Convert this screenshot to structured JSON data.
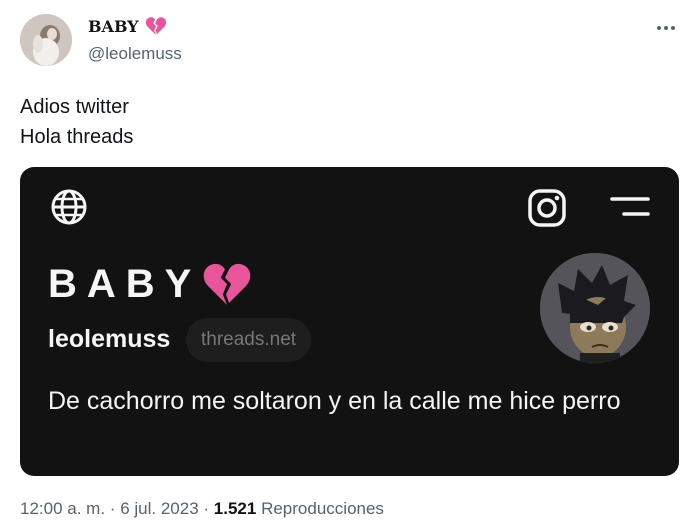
{
  "author": {
    "display_name": "BABY",
    "display_emoji": "broken-heart-icon",
    "handle": "@leolemuss"
  },
  "tweet": {
    "lines": [
      "Adios twitter",
      "Hola threads"
    ]
  },
  "card": {
    "name": "BABY",
    "username": "leolemuss",
    "domain": "threads.net",
    "bio": "De cachorro me soltaron y en la calle me hice perro",
    "icons": [
      "globe-icon",
      "instagram-icon",
      "menu-icon"
    ],
    "background": "#121212"
  },
  "meta": {
    "time": "12:00 a. m.",
    "sep1": "·",
    "date": "6 jul. 2023",
    "sep2": "·",
    "views": "1.521",
    "views_label": "Reproducciones"
  },
  "colors": {
    "text": "#0f1419",
    "secondary": "#536471",
    "broken_heart": "#e8559a"
  }
}
